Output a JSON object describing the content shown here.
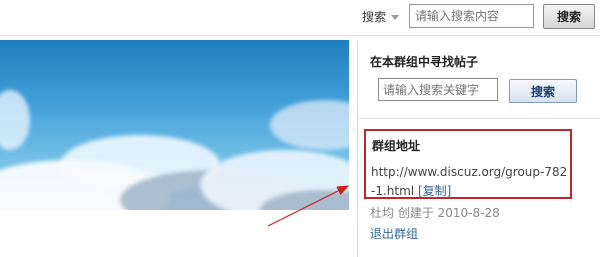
{
  "topbar": {
    "scope_label": "搜索",
    "search_placeholder": "请输入搜索内容",
    "search_button": "搜索"
  },
  "sidebar": {
    "find_title": "在本群组中寻找帖子",
    "find_placeholder": "请输入搜索关键字",
    "find_button": "搜索",
    "address": {
      "title": "群组地址",
      "url": "http://www.discuz.org/group-782-1.html",
      "copy_label": "[复制]"
    },
    "meta": "杜均 创建于 2010-8-28",
    "quit_label": "退出群组"
  },
  "colors": {
    "highlight_border": "#c0262d",
    "link": "#336699",
    "arrow": "#cc2222"
  }
}
